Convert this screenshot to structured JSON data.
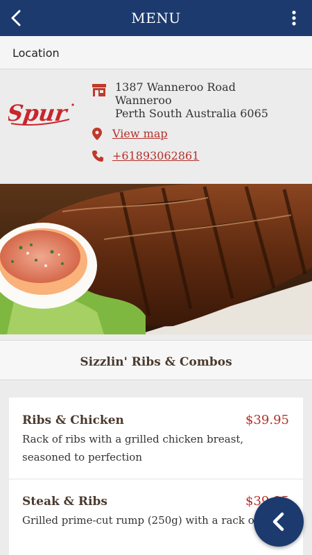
{
  "appbar": {
    "title": "MENU",
    "back_icon": "chevron-left-icon",
    "more_icon": "more-vertical-icon"
  },
  "section": {
    "label": "Location"
  },
  "location": {
    "logo_text": "Spur",
    "address_lines": [
      "1387 Wanneroo Road",
      "Wanneroo",
      "Perth South Australia 6065"
    ],
    "map_label": "View map",
    "phone": "+61893062861"
  },
  "category": {
    "title": "Sizzlin' Ribs & Combos"
  },
  "items": [
    {
      "name": "Ribs & Chicken",
      "price": "$39.95",
      "description": "Rack of ribs with a grilled chicken breast, seasoned to perfection"
    },
    {
      "name": "Steak & Ribs",
      "price": "$39.95",
      "description": "Grilled prime-cut rump (250g) with a rack of ribs"
    }
  ],
  "fab": {
    "icon": "chevron-left-icon"
  },
  "colors": {
    "primary": "#1c3a6e",
    "accent": "#b5302a",
    "heading": "#4a3a2e"
  }
}
